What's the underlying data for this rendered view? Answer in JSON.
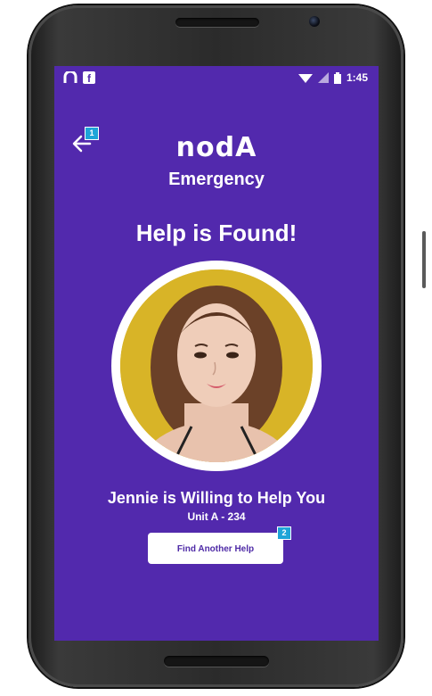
{
  "status_bar": {
    "time": "1:45",
    "icons": [
      "nod-app-icon",
      "facebook-icon",
      "wifi-icon",
      "signal-icon",
      "battery-icon"
    ]
  },
  "header": {
    "logo_text": "nodA",
    "subtitle": "Emergency",
    "back_icon": "back-arrow-icon",
    "back_marker": "1"
  },
  "main": {
    "headline": "Help is Found!",
    "helper_message": "Jennie is Willing to Help You",
    "unit": "Unit A - 234",
    "button_label": "Find Another Help",
    "button_marker": "2"
  },
  "colors": {
    "background": "#5229ad",
    "accent_marker": "#1ea4d8",
    "button_text": "#4e2aa6",
    "avatar_bg": "#d8b427"
  }
}
